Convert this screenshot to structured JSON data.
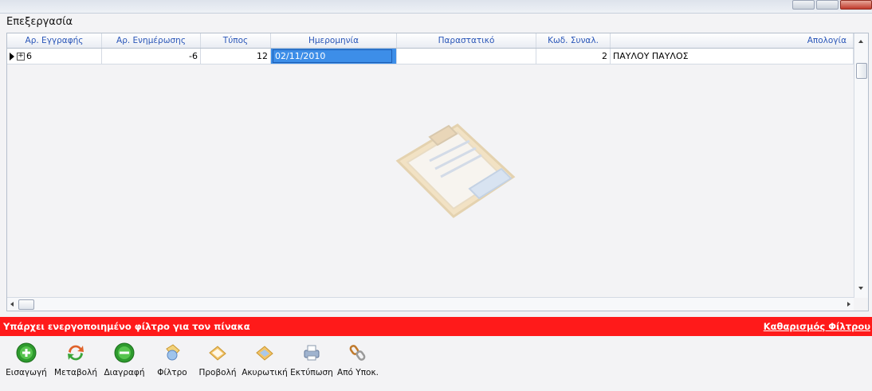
{
  "header": {
    "caption": "Επεξεργασία"
  },
  "grid": {
    "columns": [
      "Αρ. Εγγραφής",
      "Αρ. Ενημέρωσης",
      "Τύπος",
      "Ημερομηνία",
      "Παραστατικό",
      "Κωδ. Συναλ.",
      "Απολογία"
    ],
    "row": {
      "record": "6",
      "update_no": "-6",
      "type": "12",
      "date": "02/11/2010",
      "document": "",
      "trader_code": "2",
      "name": "ΠΑΥΛΟΥ ΠΑΥΛΟΣ"
    }
  },
  "filter_bar": {
    "message": "Υπάρχει ενεργοποιημένο φίλτρο για τον πίνακα",
    "clear_link": "Καθαρισμός Φίλτρου",
    "color": "#ff1a1a"
  },
  "toolbar": {
    "buttons": [
      {
        "label": "Εισαγωγή",
        "icon": "add-icon"
      },
      {
        "label": "Μεταβολή",
        "icon": "refresh-icon"
      },
      {
        "label": "Διαγραφή",
        "icon": "delete-icon"
      },
      {
        "label": "Φίλτρο",
        "icon": "filter-icon"
      },
      {
        "label": "Προβολή",
        "icon": "view-icon"
      },
      {
        "label": "Ακυρωτική",
        "icon": "cancel-doc-icon"
      },
      {
        "label": "Εκτύπωση",
        "icon": "print-icon"
      },
      {
        "label": "Από Υποκ.",
        "icon": "chain-link-icon"
      }
    ]
  }
}
